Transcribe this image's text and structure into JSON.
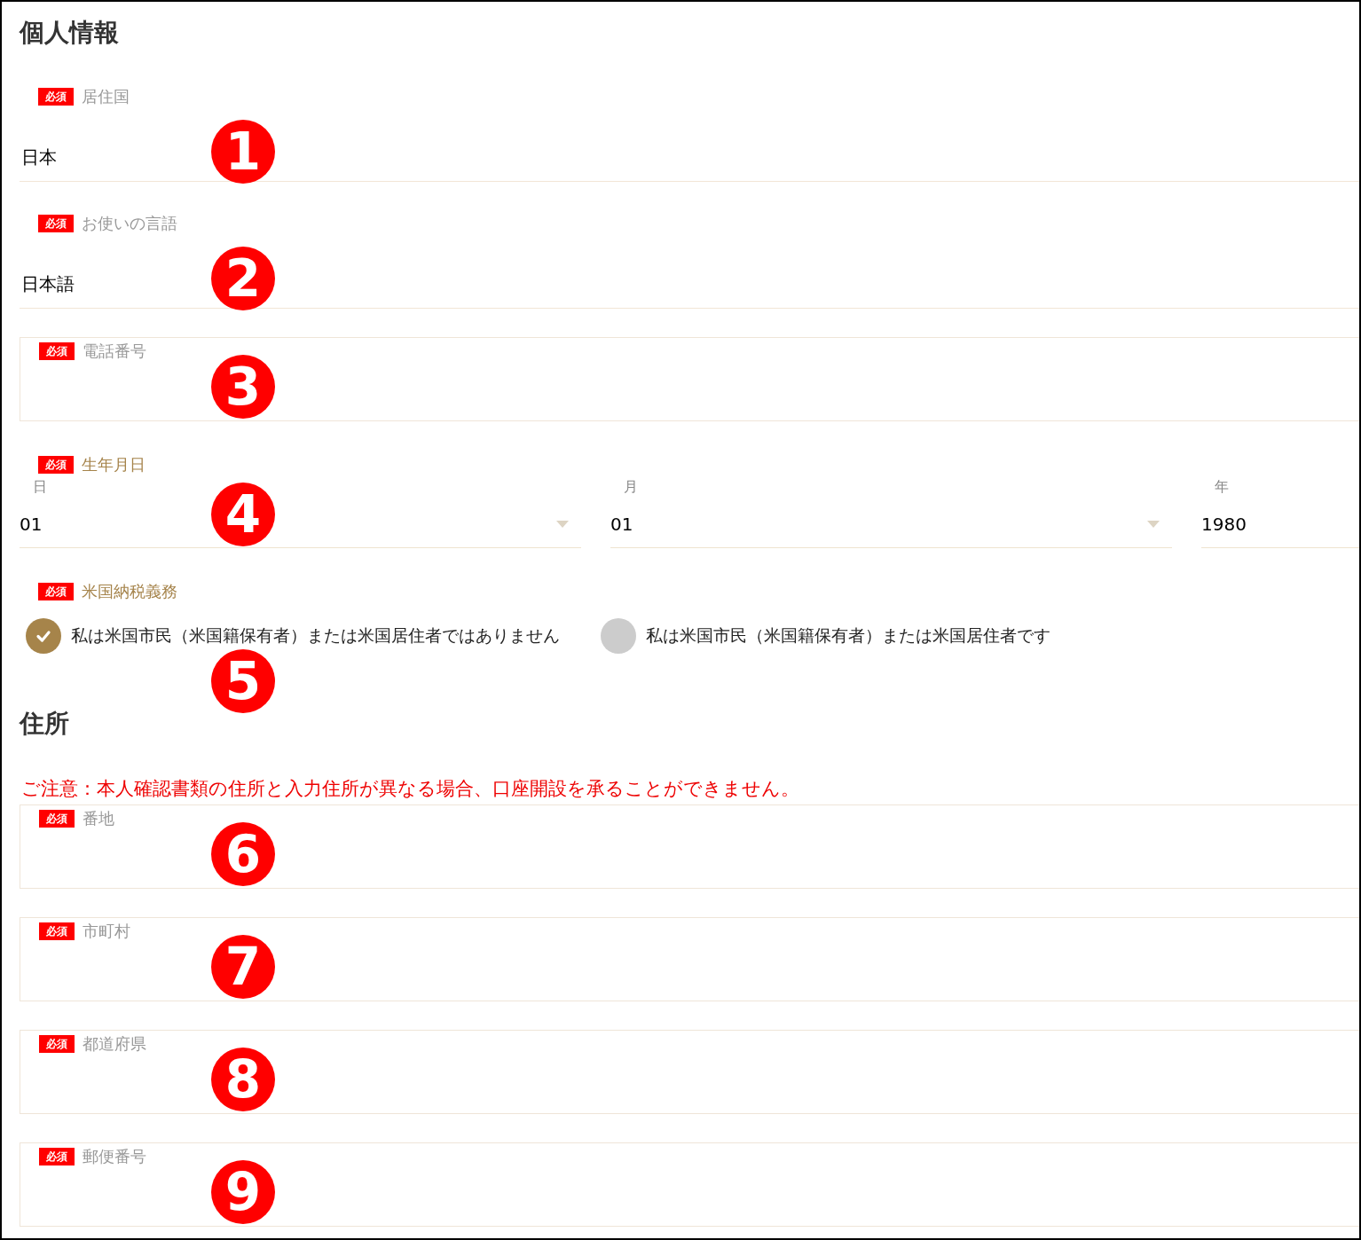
{
  "sections": [
    {
      "title": "個人情報",
      "fields": [
        {
          "kind": "line",
          "badge": "必須",
          "label": "居住国",
          "highlighted": false,
          "value": "日本",
          "marker": "1"
        },
        {
          "kind": "line",
          "badge": "必須",
          "label": "お使いの言語",
          "highlighted": false,
          "value": "日本語",
          "marker": "2"
        },
        {
          "kind": "box",
          "badge": "必須",
          "label": "電話番号",
          "highlighted": false,
          "marker": "3"
        },
        {
          "kind": "date",
          "badge": "必須",
          "label": "生年月日",
          "highlighted": true,
          "parts": [
            {
              "label": "日",
              "value": "01",
              "dropdown": true
            },
            {
              "label": "月",
              "value": "01",
              "dropdown": true
            },
            {
              "label": "年",
              "value": "1980",
              "dropdown": false
            }
          ],
          "marker": "4"
        },
        {
          "kind": "radio",
          "badge": "必須",
          "label": "米国納税義務",
          "highlighted": true,
          "options": [
            {
              "label": "私は米国市民（米国籍保有者）または米国居住者ではありません",
              "selected": true
            },
            {
              "label": "私は米国市民（米国籍保有者）または米国居住者です",
              "selected": false
            }
          ],
          "marker": "5"
        }
      ]
    },
    {
      "title": "住所",
      "notice": "ご注意：本人確認書類の住所と入力住所が異なる場合、口座開設を承ることができません。",
      "fields": [
        {
          "kind": "box",
          "badge": "必須",
          "label": "番地",
          "highlighted": false,
          "marker": "6"
        },
        {
          "kind": "box",
          "badge": "必須",
          "label": "市町村",
          "highlighted": false,
          "marker": "7"
        },
        {
          "kind": "box",
          "badge": "必須",
          "label": "都道府県",
          "highlighted": false,
          "marker": "8"
        },
        {
          "kind": "box",
          "badge": "必須",
          "label": "郵便番号",
          "highlighted": false,
          "marker": "9"
        }
      ]
    }
  ]
}
